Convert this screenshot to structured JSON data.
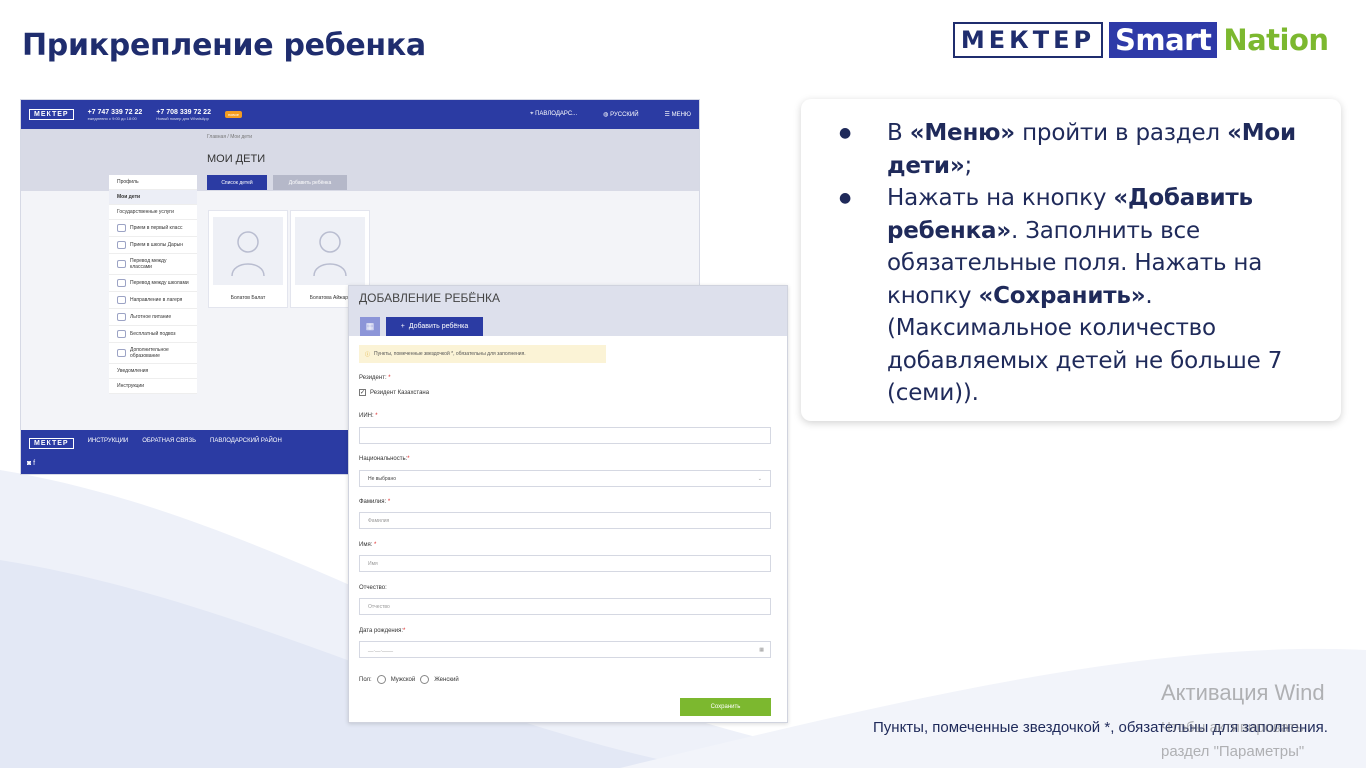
{
  "slide": {
    "title": "Прикрепление ребенка",
    "logo": {
      "left": "МЕКТЕР",
      "smart": "Smart",
      "nation": "Nation"
    }
  },
  "portal": {
    "logo": "МЕКТЕР",
    "phone1": "+7 747 339 72 22",
    "phone1_sub": "ежедневно с 9:00 до 18:00",
    "phone2": "+7 708 339 72 22",
    "phone2_sub": "Новый номер для WhatsApp",
    "badge": "новое",
    "region": "ПАВЛОДАРС...",
    "language": "РУССКИЙ",
    "menu": "МЕНЮ",
    "breadcrumb": "Главная / Мои дети",
    "page_title": "МОИ ДЕТИ",
    "tab_list": "Список детей",
    "tab_add": "Добавить ребёнка",
    "sidebar": [
      "Профиль",
      "Мои дети",
      "Государственные услуги",
      "Прием в первый класс",
      "Прием в школы Дарын",
      "Перевод между классами",
      "Перевод между школами",
      "Направление в лагеря",
      "Льготное питание",
      "Бесплатный подвоз",
      "Дополнительное образование",
      "Уведомления",
      "Инструкции"
    ],
    "children": [
      "Болатов Балат",
      "Болатова Айжарк"
    ],
    "footer_links": [
      "ИНСТРУКЦИИ",
      "ОБРАТНАЯ СВЯЗЬ",
      "ПАВЛОДАРСКИЙ РАЙОН"
    ]
  },
  "form": {
    "title": "ДОБАВЛЕНИЕ РЕБЁНКА",
    "add_button": "Добавить ребёнка",
    "note": "Пункты, помеченные звездочкой *, обязательны для заполнения.",
    "resident_label": "Резидент:",
    "resident_checkbox": "Резидент Казахстана",
    "iin_label": "ИИН:",
    "nationality_label": "Национальность:",
    "nationality_value": "Не выбрано",
    "lastname_label": "Фамилия:",
    "lastname_placeholder": "Фамилия",
    "firstname_label": "Имя:",
    "firstname_placeholder": "Имя",
    "patronymic_label": "Отчество:",
    "patronymic_placeholder": "Отчество",
    "birthdate_label": "Дата рождения:",
    "birthdate_placeholder": "__.__.____",
    "gender_label": "Пол:",
    "gender_male": "Мужской",
    "gender_female": "Женский",
    "save_button": "Сохранить"
  },
  "info": {
    "item1": {
      "p1": "В ",
      "b1": "«Меню»",
      "p2": " пройти в раздел ",
      "b2": "«Мои дети»",
      "p3": ";"
    },
    "item2": {
      "p1": "Нажать на кнопку ",
      "b1": "«Добавить ребенка»",
      "p2": ". Заполнить все обязательные поля. Нажать на кнопку ",
      "b2": "«Сохранить»",
      "p3": ". (Максимальное количество добавляемых детей не больше 7 (семи))."
    }
  },
  "footnote": "Пункты, помеченные звездочкой *, обязательны для заполнения.",
  "activation": {
    "title": "Активация Wind",
    "line1": "Чтобы активировать",
    "line2": "раздел \"Параметры\""
  },
  "colors": {
    "primary": "#2b3ba3",
    "accent_green": "#7cb82f",
    "text_dark": "#1f2a5a"
  }
}
